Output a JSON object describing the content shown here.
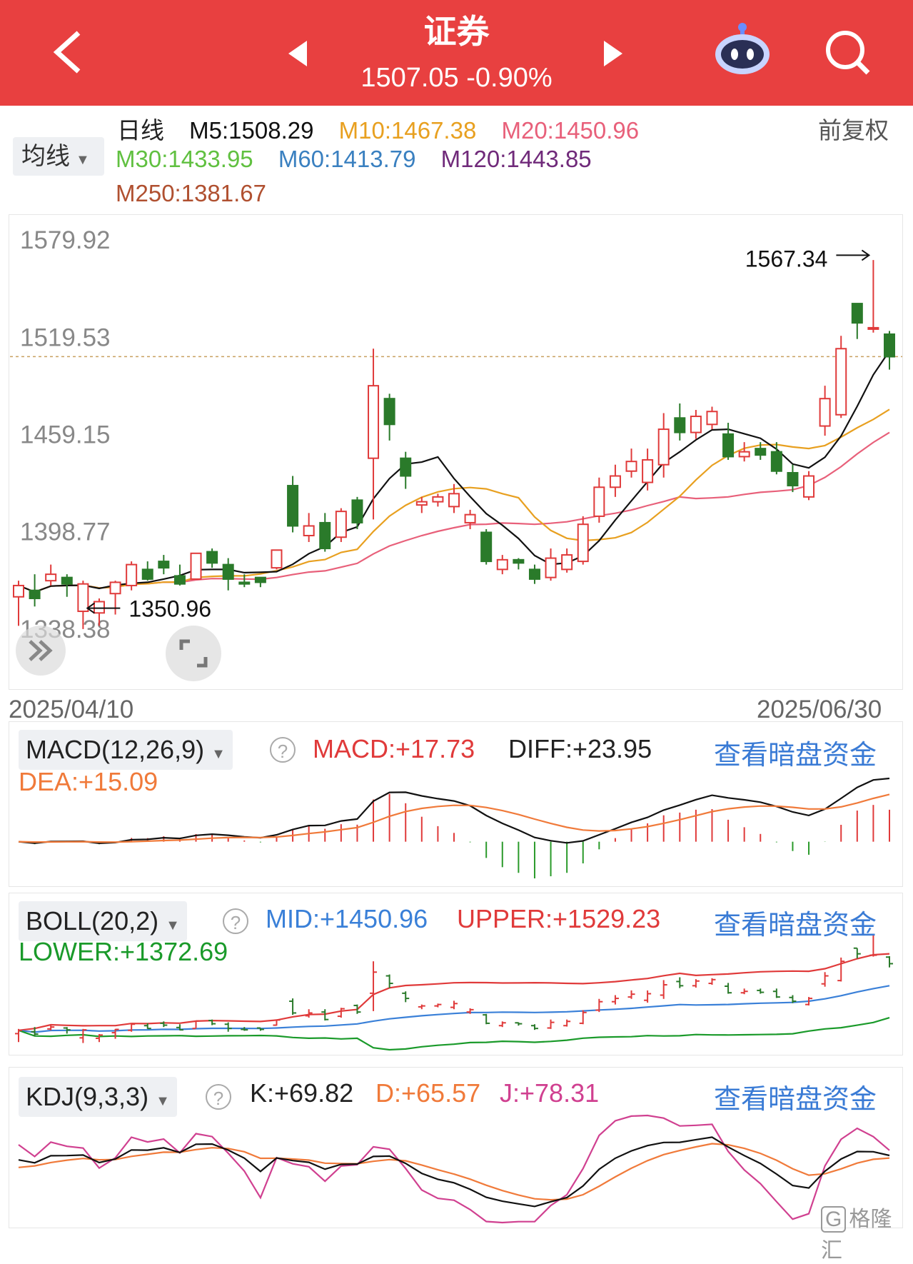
{
  "header": {
    "title": "证券",
    "price_line": "1507.05 -0.90%",
    "bg": "#e84040"
  },
  "ma_panel": {
    "period": "日线",
    "mode": "前复权",
    "dropdown": "均线",
    "items": [
      {
        "label": "M5:1508.29",
        "color": "#111111"
      },
      {
        "label": "M10:1467.38",
        "color": "#e8a020"
      },
      {
        "label": "M20:1450.96",
        "color": "#e8607a"
      },
      {
        "label": "M30:1433.95",
        "color": "#60c040"
      },
      {
        "label": "M60:1413.79",
        "color": "#3a80c0"
      },
      {
        "label": "M120:1443.85",
        "color": "#702a7a"
      },
      {
        "label": "M250:1381.67",
        "color": "#b05030"
      }
    ]
  },
  "chart_data": {
    "type": "candlestick",
    "y_ticks": [
      "1579.92",
      "1519.53",
      "1459.15",
      "1398.77",
      "1338.38"
    ],
    "ylim": [
      1338.38,
      1579.92
    ],
    "date_start": "2025/04/10",
    "date_end": "2025/06/30",
    "high_label": "1567.34",
    "low_label": "1350.96",
    "current_price": 1507.05,
    "candles": [
      [
        1358,
        1365,
        1368,
        1340
      ],
      [
        1362,
        1357,
        1372,
        1352
      ],
      [
        1368,
        1372,
        1378,
        1365
      ],
      [
        1370,
        1366,
        1372,
        1358
      ],
      [
        1349,
        1366,
        1368,
        1338
      ],
      [
        1348,
        1355,
        1357,
        1340
      ],
      [
        1360,
        1367,
        1368,
        1347
      ],
      [
        1365,
        1378,
        1380,
        1362
      ],
      [
        1375,
        1369,
        1380,
        1368
      ],
      [
        1380,
        1376,
        1384,
        1372
      ],
      [
        1371,
        1366,
        1378,
        1365
      ],
      [
        1369,
        1385,
        1385,
        1370
      ],
      [
        1386,
        1379,
        1388,
        1376
      ],
      [
        1378,
        1369,
        1382,
        1362
      ],
      [
        1367,
        1366,
        1372,
        1364
      ],
      [
        1370,
        1367,
        1370,
        1364
      ],
      [
        1376,
        1387,
        1387,
        1375
      ],
      [
        1427,
        1402,
        1433,
        1398
      ],
      [
        1396,
        1402,
        1410,
        1392
      ],
      [
        1404,
        1388,
        1410,
        1386
      ],
      [
        1395,
        1411,
        1413,
        1392
      ],
      [
        1418,
        1404,
        1420,
        1400
      ],
      [
        1444,
        1489,
        1512,
        1406
      ],
      [
        1481,
        1465,
        1484,
        1455
      ],
      [
        1444,
        1433,
        1448,
        1425
      ],
      [
        1415,
        1417,
        1420,
        1410
      ],
      [
        1417,
        1420,
        1422,
        1414
      ],
      [
        1414,
        1422,
        1428,
        1410
      ],
      [
        1404,
        1409,
        1412,
        1400
      ],
      [
        1398,
        1380,
        1400,
        1378
      ],
      [
        1375,
        1381,
        1384,
        1372
      ],
      [
        1381,
        1379,
        1382,
        1375
      ],
      [
        1375,
        1369,
        1378,
        1366
      ],
      [
        1370,
        1382,
        1388,
        1368
      ],
      [
        1375,
        1384,
        1388,
        1373
      ],
      [
        1380,
        1403,
        1408,
        1378
      ],
      [
        1408,
        1426,
        1432,
        1404
      ],
      [
        1426,
        1433,
        1440,
        1420
      ],
      [
        1436,
        1442,
        1450,
        1432
      ],
      [
        1429,
        1443,
        1450,
        1424
      ],
      [
        1440,
        1462,
        1472,
        1432
      ],
      [
        1469,
        1460,
        1478,
        1455
      ],
      [
        1460,
        1470,
        1474,
        1456
      ],
      [
        1465,
        1473,
        1476,
        1462
      ],
      [
        1459,
        1445,
        1466,
        1443
      ],
      [
        1445,
        1448,
        1454,
        1442
      ],
      [
        1450,
        1446,
        1454,
        1443
      ],
      [
        1448,
        1436,
        1454,
        1434
      ],
      [
        1435,
        1427,
        1440,
        1423
      ],
      [
        1420,
        1433,
        1436,
        1418
      ],
      [
        1464,
        1481,
        1489,
        1458
      ],
      [
        1471,
        1512,
        1520,
        1469
      ],
      [
        1540,
        1528,
        1540,
        1518
      ],
      [
        1525,
        1525,
        1567,
        1522
      ],
      [
        1521,
        1507,
        1523,
        1499
      ]
    ]
  },
  "macd": {
    "dropdown": "MACD(12,26,9)",
    "macd": "MACD:+17.73",
    "diff": "DIFF:+23.95",
    "dea": "DEA:+15.09",
    "link": "查看暗盘资金"
  },
  "boll": {
    "dropdown": "BOLL(20,2)",
    "mid": "MID:+1450.96",
    "upper": "UPPER:+1529.23",
    "lower": "LOWER:+1372.69",
    "link": "查看暗盘资金"
  },
  "kdj": {
    "dropdown": "KDJ(9,3,3)",
    "k": "K:+69.82",
    "d": "D:+65.57",
    "j": "J:+78.31",
    "link": "查看暗盘资金"
  },
  "watermark": "格隆汇"
}
